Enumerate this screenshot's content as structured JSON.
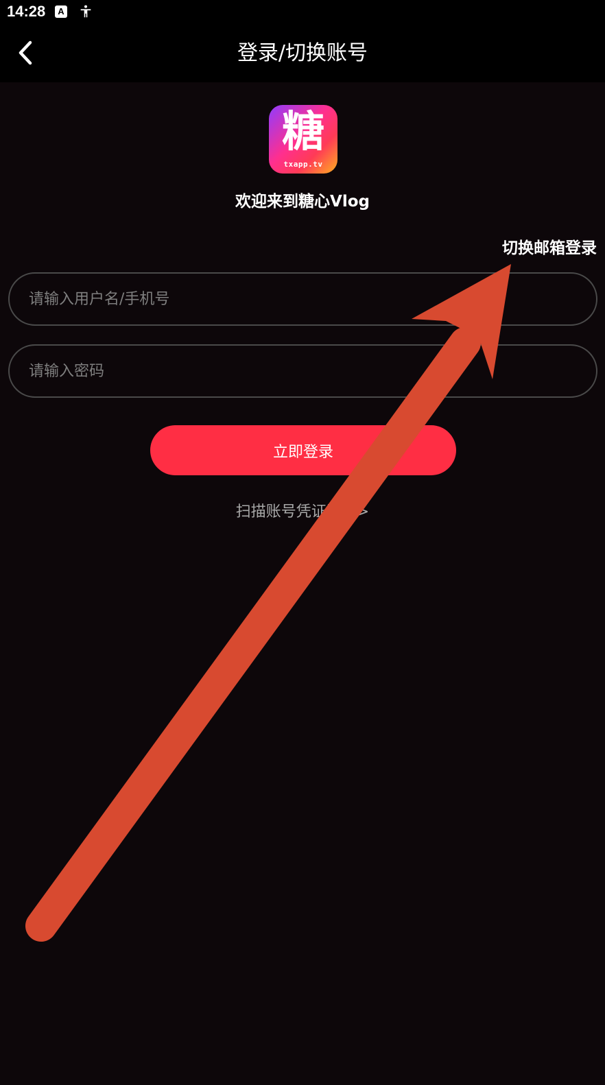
{
  "status_bar": {
    "time": "14:28",
    "icons": [
      "text-a-icon",
      "accessibility-icon"
    ],
    "a_label": "A"
  },
  "nav": {
    "title": "登录/切换账号",
    "back_icon": "chevron-left-icon"
  },
  "logo": {
    "glyph": "糖",
    "domain": "txapp.tv"
  },
  "welcome": "欢迎来到糖心Vlog",
  "switch_email": "切换邮箱登录",
  "form": {
    "username_placeholder": "请输入用户名/手机号",
    "password_placeholder": "请输入密码",
    "username_value": "",
    "password_value": ""
  },
  "login_button": "立即登录",
  "scan_link": "扫描账号凭证登录>",
  "colors": {
    "background": "#0d070a",
    "bar": "#000000",
    "accent": "#ff2e44",
    "input_border": "#4a4a4a",
    "placeholder": "#7e7e7e",
    "muted_text": "#a8a8a8",
    "annotation": "#d84a30"
  }
}
